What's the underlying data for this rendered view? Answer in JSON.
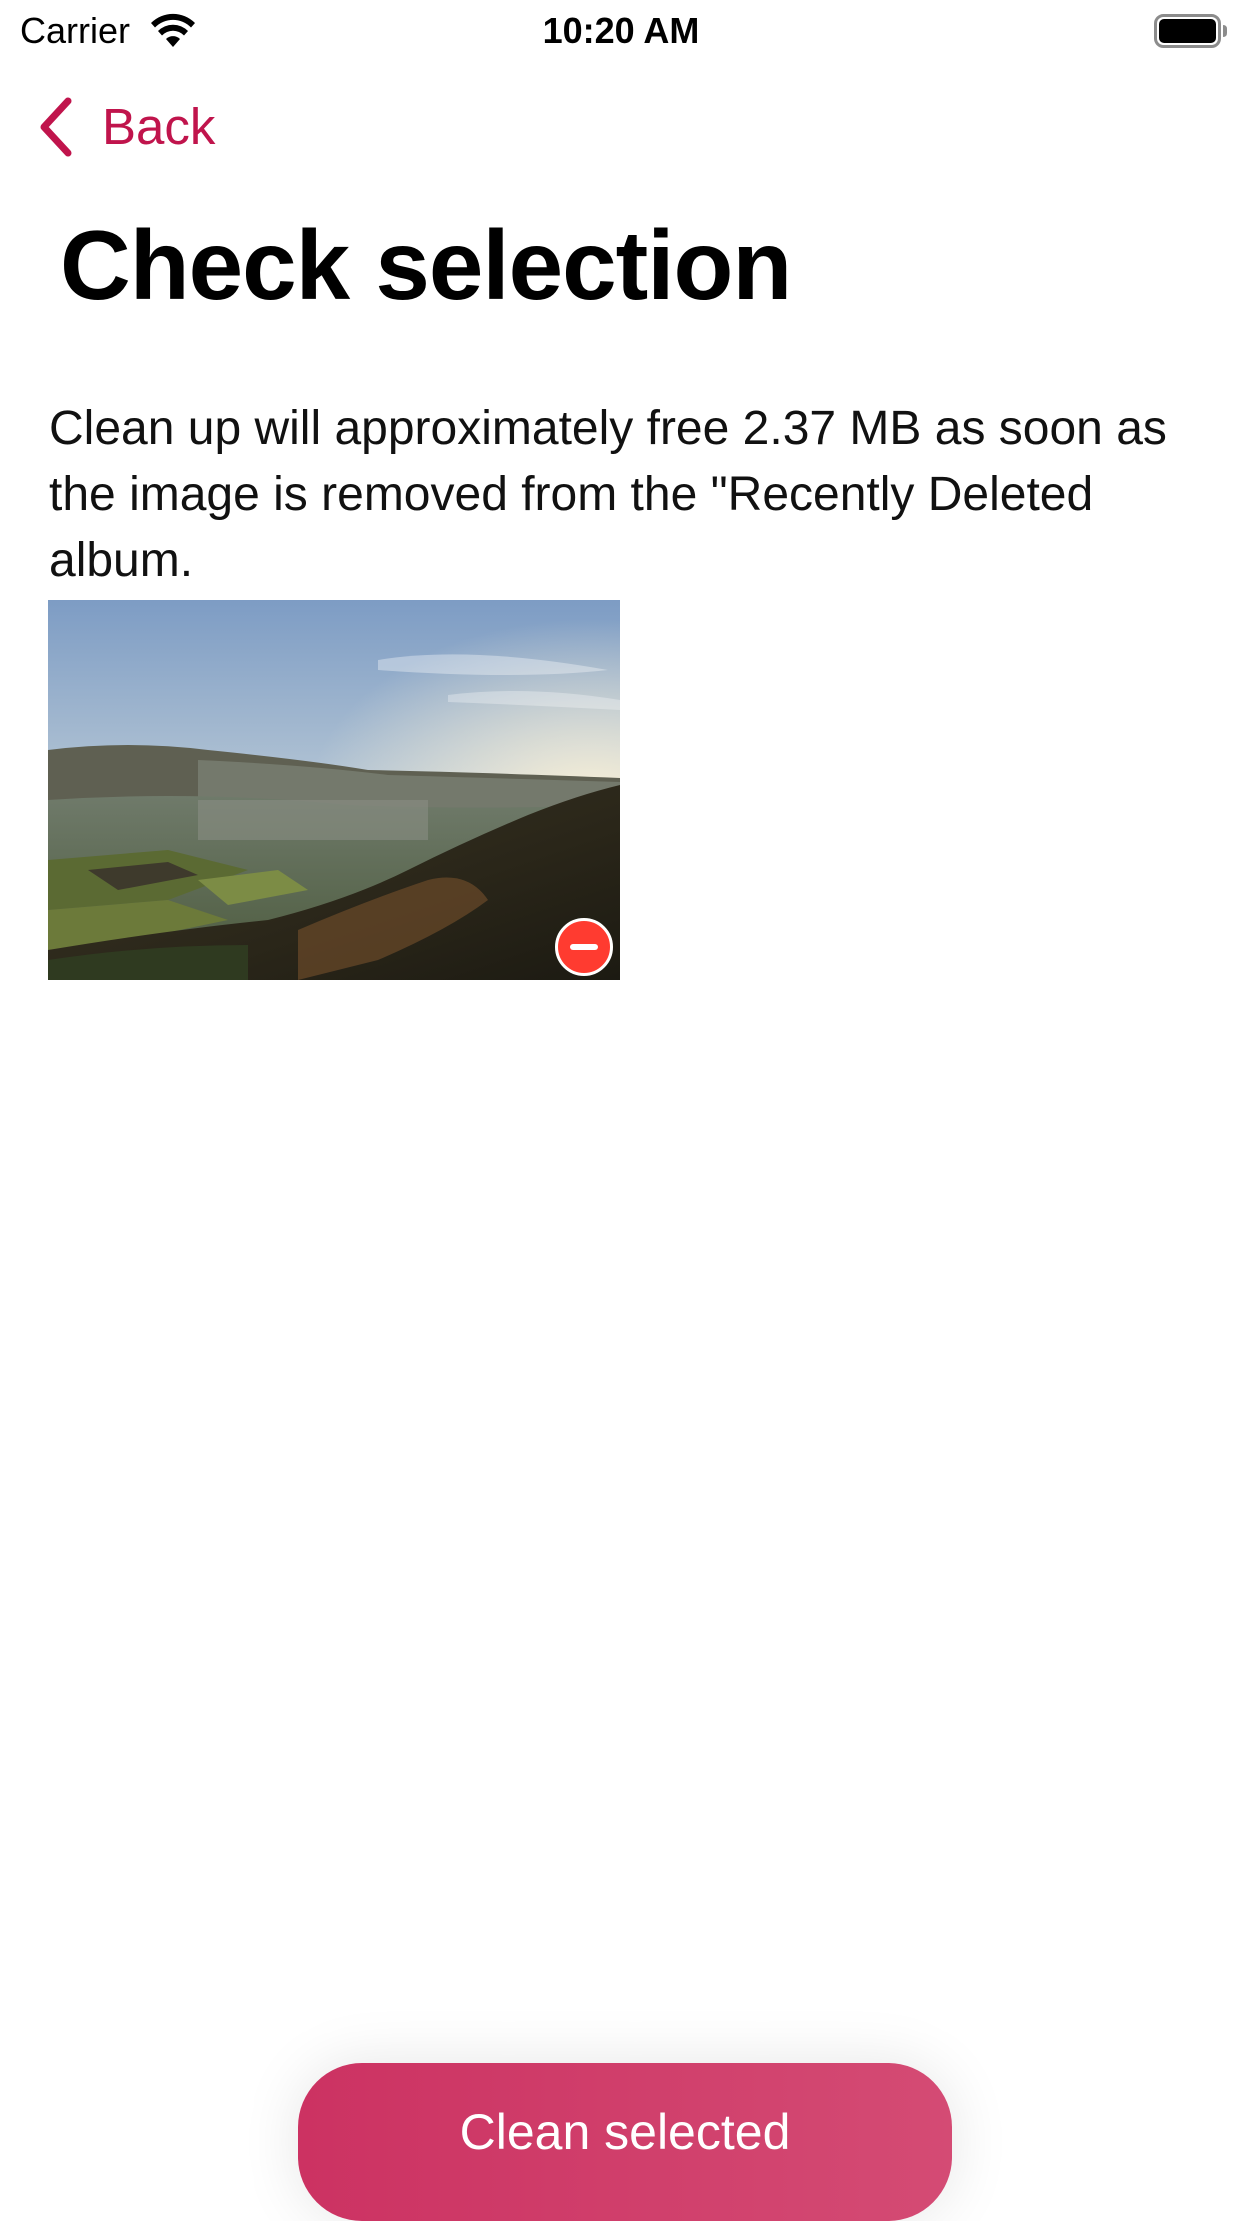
{
  "status_bar": {
    "carrier": "Carrier",
    "time": "10:20 AM",
    "icons": [
      "wifi-icon",
      "battery-icon"
    ]
  },
  "nav": {
    "back_label": "Back",
    "back_icon": "chevron-left-icon",
    "accent_color": "#c0144c"
  },
  "page": {
    "title": "Check selection",
    "description": "Clean up will approximately free 2.37 MB as soon as the image is removed from the \"Recently Deleted album."
  },
  "selection": {
    "items": [
      {
        "type": "photo",
        "badge_icon": "remove-circle-icon",
        "badge_color": "#ff3b30"
      }
    ]
  },
  "actions": {
    "clean_label": "Clean selected",
    "button_color": "#cc3262"
  }
}
